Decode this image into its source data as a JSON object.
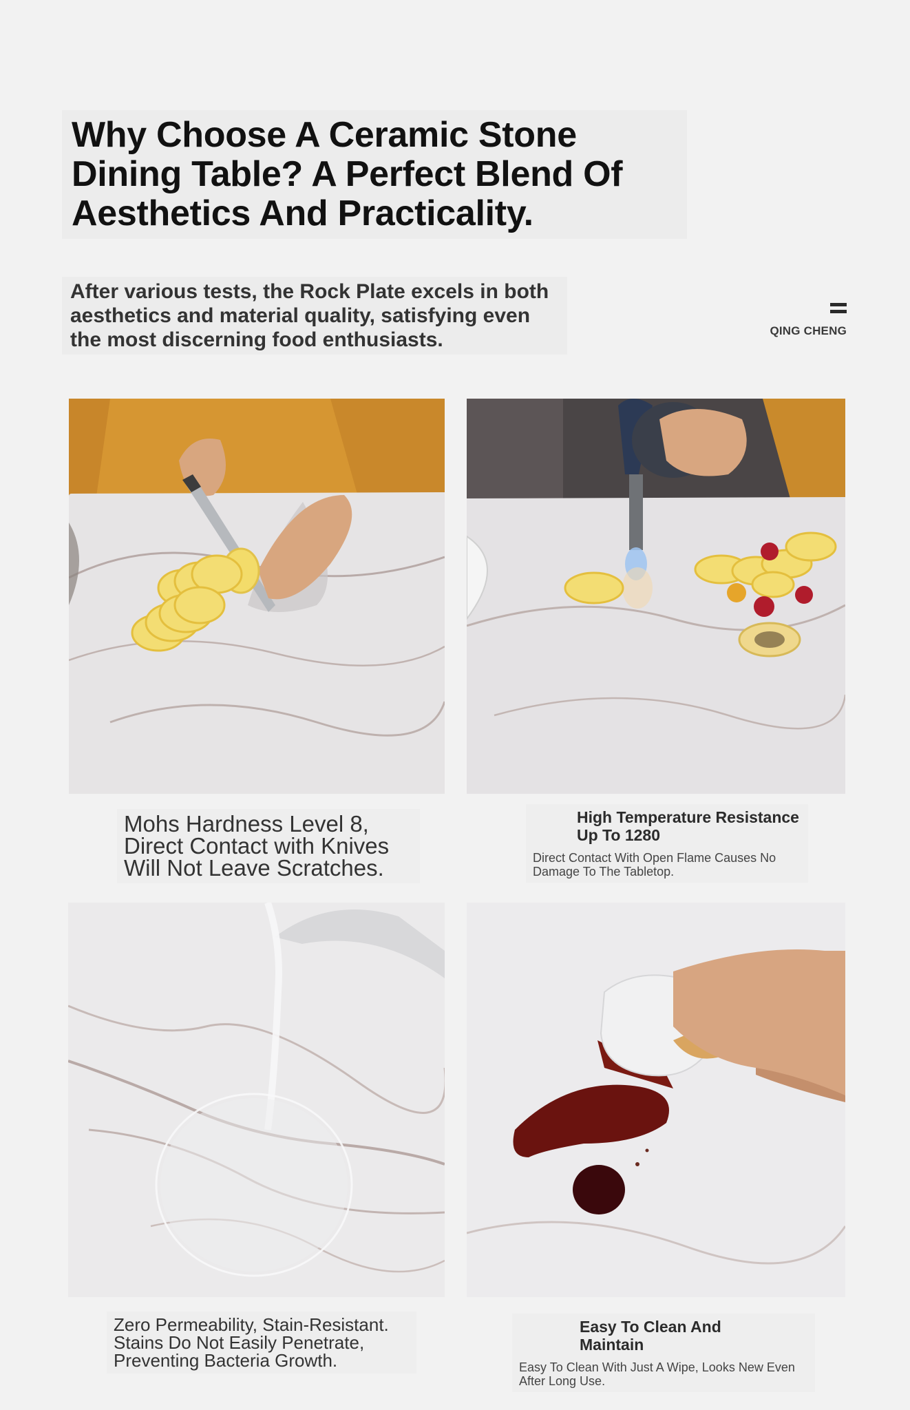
{
  "headline": "Why Choose A Ceramic Stone Dining Table? A Perfect Blend Of Aesthetics And Practicality.",
  "intro": "After various tests, the Rock Plate excels in both aesthetics and material quality, satisfying even the most discerning food enthusiasts.",
  "brand": {
    "name": "QING CHENG",
    "icon": "double-bar-icon"
  },
  "features": [
    {
      "caption": "Mohs Hardness Level 8, Direct Contact with Knives Will Not Leave Scratches.",
      "photo": "knife-slicing-lemon-on-marble-photo"
    },
    {
      "title": "High Temperature Resistance Up To 1280",
      "description": "Direct Contact With Open Flame Causes No Damage To The Tabletop.",
      "photo": "blowtorch-flame-on-marble-photo"
    },
    {
      "caption": "Zero Permeability, Stain-Resistant. Stains Do Not Easily Penetrate, Preventing Bacteria Growth.",
      "photo": "water-pouring-on-marble-photo"
    },
    {
      "title": "Easy To Clean And Maintain",
      "description": "Easy To Clean With Just A Wipe, Looks New Even After Long Use.",
      "photo": "cloth-wiping-spill-photo"
    }
  ]
}
